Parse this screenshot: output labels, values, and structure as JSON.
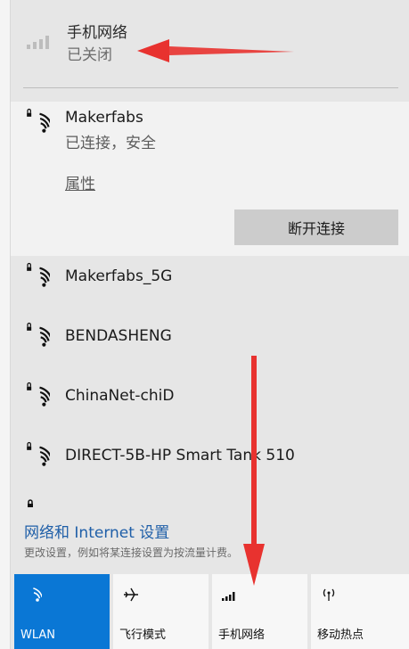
{
  "cellular_header": {
    "title": "手机网络",
    "status": "已关闭"
  },
  "connected_network": {
    "name": "Makerfabs",
    "status": "已连接，安全",
    "properties_label": "属性",
    "disconnect_label": "断开连接"
  },
  "networks": [
    {
      "name": "Makerfabs_5G"
    },
    {
      "name": "BENDASHENG"
    },
    {
      "name": "ChinaNet-chiD"
    },
    {
      "name": "DIRECT-5B-HP Smart Tank 510"
    }
  ],
  "settings": {
    "link": "网络和 Internet 设置",
    "hint": "更改设置，例如将某连接设置为按流量计费。"
  },
  "quick_actions": [
    {
      "label": "WLAN",
      "icon": "wifi-icon",
      "active": true
    },
    {
      "label": "飞行模式",
      "icon": "airplane-icon",
      "active": false
    },
    {
      "label": "手机网络",
      "icon": "signal-bars-icon",
      "active": false
    },
    {
      "label": "移动热点",
      "icon": "hotspot-icon",
      "active": false
    }
  ],
  "colors": {
    "accent": "#0a77d5",
    "link": "#1f5fa8",
    "arrow": "#e8322f"
  }
}
